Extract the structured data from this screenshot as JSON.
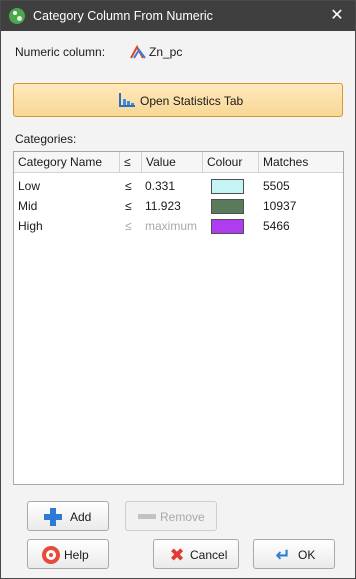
{
  "window": {
    "title": "Category Column From Numeric",
    "close_glyph": "✕",
    "app_icon": "leapfrog-icon"
  },
  "numeric": {
    "label": "Numeric column:",
    "column_name": "Zn_pc",
    "column_icon": "numeric-column-icon"
  },
  "stats_button": {
    "label": "Open Statistics Tab",
    "icon": "statistics-chart-icon"
  },
  "categories_label": "Categories:",
  "table": {
    "headers": [
      "Category Name",
      "≤",
      "Value",
      "Colour",
      "Matches"
    ],
    "rows": [
      {
        "name": "Low",
        "lte": "≤",
        "value": "0.331",
        "colour": "#c4f4f4",
        "matches": "5505",
        "muted": false
      },
      {
        "name": "Mid",
        "lte": "≤",
        "value": "11.923",
        "colour": "#5a7a5c",
        "matches": "10937",
        "muted": false
      },
      {
        "name": "High",
        "lte": "≤",
        "value": "maximum",
        "colour": "#b03cf2",
        "matches": "5466",
        "muted": true
      }
    ]
  },
  "buttons": {
    "add": "Add",
    "remove": "Remove",
    "help": "Help",
    "cancel": "Cancel",
    "ok": "OK"
  },
  "colors": {
    "titlebar": "#3f3f3f",
    "accent_button": "#f7d795",
    "accent_border": "#d79a2a"
  }
}
